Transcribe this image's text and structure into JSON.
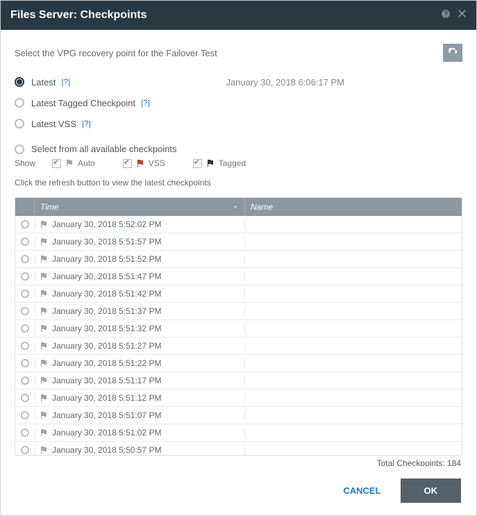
{
  "title": "Files Server: Checkpoints",
  "instruction": "Select the VPG recovery point for the Failover Test",
  "radios": {
    "latest": {
      "label": "Latest",
      "help": "|?|",
      "date": "January 30, 2018 6:06:17 PM"
    },
    "tagged": {
      "label": "Latest Tagged Checkpoint",
      "help": "|?|"
    },
    "vss": {
      "label": "Latest VSS",
      "help": "|?|"
    },
    "all": {
      "label": "Select from all available checkpoints"
    }
  },
  "filter": {
    "show": "Show",
    "auto": "Auto",
    "vss": "VSS",
    "tagged": "Tagged"
  },
  "hint": "Click the refresh button to view the latest checkpoints",
  "columns": {
    "time": "Time",
    "name": "Name"
  },
  "rows": [
    {
      "time": "January 30, 2018 5:52:02 PM",
      "name": ""
    },
    {
      "time": "January 30, 2018 5:51:57 PM",
      "name": ""
    },
    {
      "time": "January 30, 2018 5:51:52 PM",
      "name": ""
    },
    {
      "time": "January 30, 2018 5:51:47 PM",
      "name": ""
    },
    {
      "time": "January 30, 2018 5:51:42 PM",
      "name": ""
    },
    {
      "time": "January 30, 2018 5:51:37 PM",
      "name": ""
    },
    {
      "time": "January 30, 2018 5:51:32 PM",
      "name": ""
    },
    {
      "time": "January 30, 2018 5:51:27 PM",
      "name": ""
    },
    {
      "time": "January 30, 2018 5:51:22 PM",
      "name": ""
    },
    {
      "time": "January 30, 2018 5:51:17 PM",
      "name": ""
    },
    {
      "time": "January 30, 2018 5:51:12 PM",
      "name": ""
    },
    {
      "time": "January 30, 2018 5:51:07 PM",
      "name": ""
    },
    {
      "time": "January 30, 2018 5:51:02 PM",
      "name": ""
    },
    {
      "time": "January 30, 2018 5:50:57 PM",
      "name": ""
    }
  ],
  "total_label": "Total Checkpoints: 184",
  "footer": {
    "cancel": "CANCEL",
    "ok": "OK"
  }
}
